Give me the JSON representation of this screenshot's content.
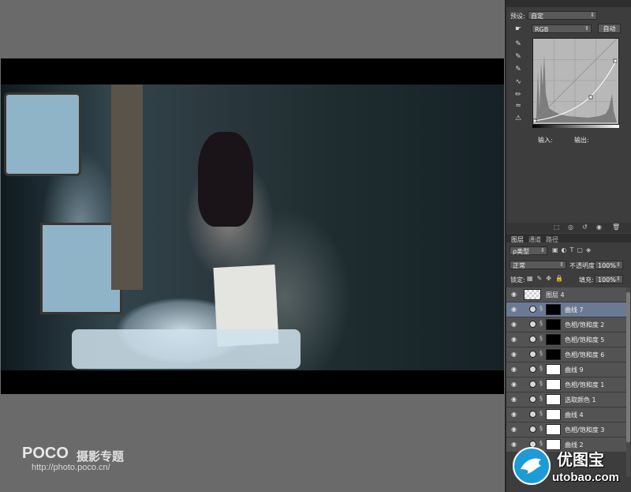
{
  "canvas": {
    "logo": "POCO",
    "logo_sub": "摄影专题",
    "url": "http://photo.poco.cn/"
  },
  "properties": {
    "preset_label": "预设:",
    "preset_value": "自定",
    "channel_value": "RGB",
    "auto_label": "自动",
    "input_label": "输入:",
    "output_label": "输出:"
  },
  "layers_panel": {
    "tabs": [
      "图层",
      "通道",
      "路径"
    ],
    "filter_value": "ρ类型",
    "blend_mode": "正常",
    "opacity_label": "不透明度:",
    "opacity_value": "100%",
    "lock_label": "锁定:",
    "fill_label": "填充:",
    "fill_value": "100%",
    "layers": [
      {
        "name": "图层 4"
      },
      {
        "name": "曲线 7",
        "selected": true
      },
      {
        "name": "色相/饱和度 2"
      },
      {
        "name": "色相/饱和度 5"
      },
      {
        "name": "色相/饱和度 6"
      },
      {
        "name": "曲线 9"
      },
      {
        "name": "色相/饱和度 1"
      },
      {
        "name": "选取颜色 1"
      },
      {
        "name": "曲线 4"
      },
      {
        "name": "色相/饱和度 3"
      },
      {
        "name": "曲线 2"
      }
    ]
  },
  "watermark": {
    "cn": "优图宝",
    "en": "utobao.com"
  }
}
